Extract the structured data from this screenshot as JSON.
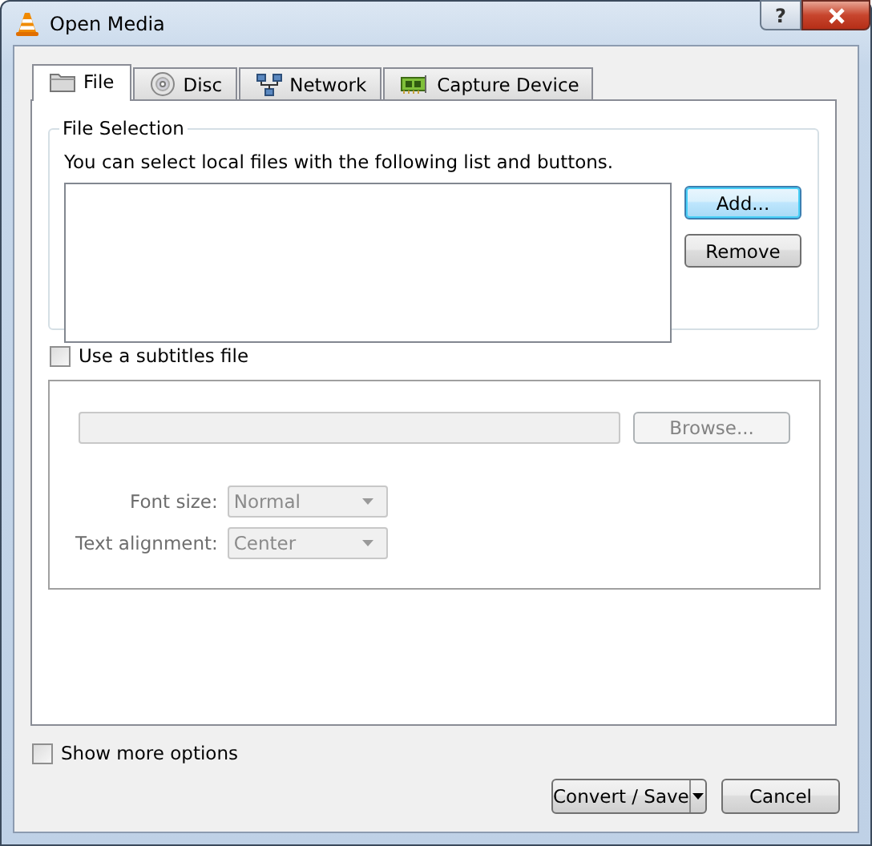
{
  "window": {
    "title": "Open Media",
    "help_button": "?"
  },
  "tabs": [
    {
      "label": "File",
      "selected": true
    },
    {
      "label": "Disc",
      "selected": false
    },
    {
      "label": "Network",
      "selected": false
    },
    {
      "label": "Capture Device",
      "selected": false
    }
  ],
  "file_selection": {
    "title": "File Selection",
    "description": "You can select local files with the following list and buttons.",
    "buttons": [
      {
        "label": "Add...",
        "focused": true
      },
      {
        "label": "Remove",
        "focused": false
      }
    ]
  },
  "subtitles": {
    "label": "Use a subtitles file",
    "checked": false,
    "disabled": true,
    "browse_button": "Browse...",
    "options": [
      {
        "label": "Font size:",
        "value": "Normal"
      },
      {
        "label": "Text alignment:",
        "value": "Center"
      }
    ]
  },
  "show_more_options": {
    "label": "Show more options",
    "checked": false
  },
  "buttons": [
    {
      "label": "Convert / Save",
      "kind": "split"
    },
    {
      "label": "Cancel",
      "kind": "plain"
    }
  ]
}
